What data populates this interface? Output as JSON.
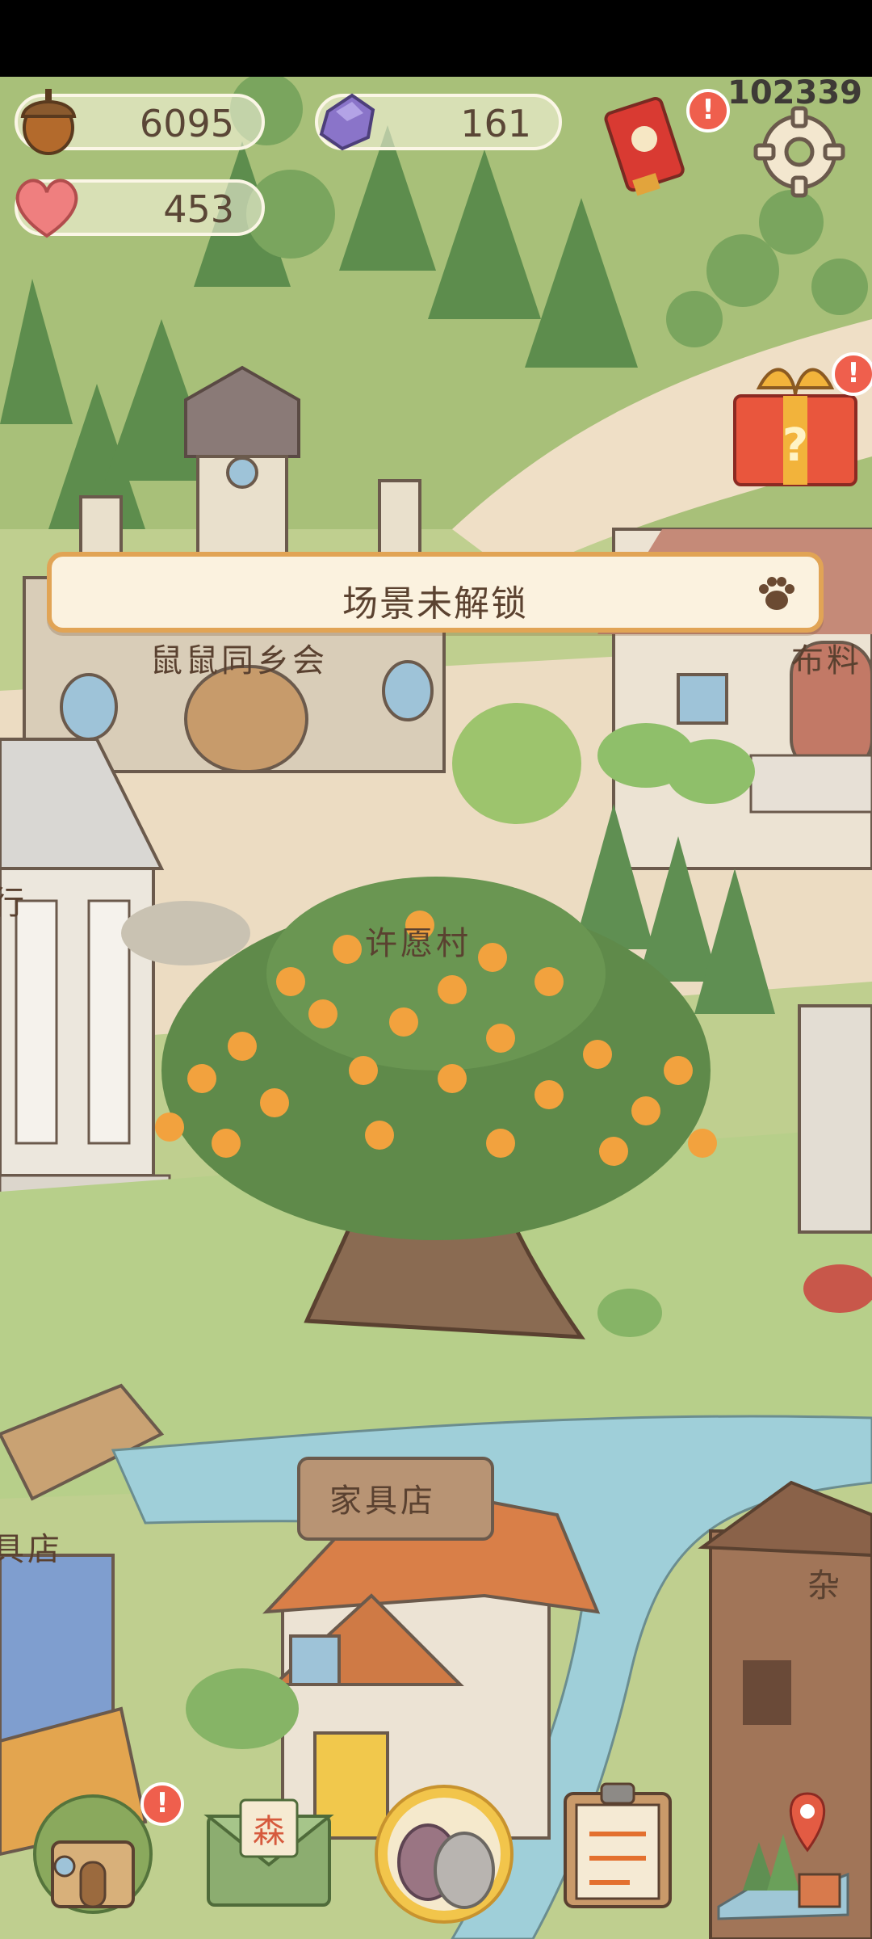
{
  "status_bar": {
    "counter": "102339"
  },
  "resources": {
    "acorns": {
      "icon": "acorn-icon",
      "value": "6095"
    },
    "gems": {
      "icon": "crystal-icon",
      "value": "161"
    },
    "hearts": {
      "icon": "heart-icon",
      "value": "453"
    }
  },
  "top_right": {
    "event_icon": "lucky-envelope-icon",
    "settings_icon": "gear-icon",
    "gift_icon": "mystery-gift-icon",
    "alert": "!"
  },
  "notice": {
    "text": "场景未解锁",
    "icon": "paw-icon"
  },
  "map_labels": {
    "town_hall": "鼠鼠同乡会",
    "fabric": "布料",
    "wish_tree": "许愿村",
    "furniture": "家具店",
    "bank_partial": "行",
    "left_store_partial": "具店",
    "right_store_partial": "杂"
  },
  "bottom_nav": {
    "home_icon": "house-icon",
    "mail_icon": "mail-icon",
    "mail_stamp": "森",
    "character_icon": "hamsters-icon",
    "tasks_icon": "clipboard-icon",
    "map_icon": "map-pin-icon"
  }
}
